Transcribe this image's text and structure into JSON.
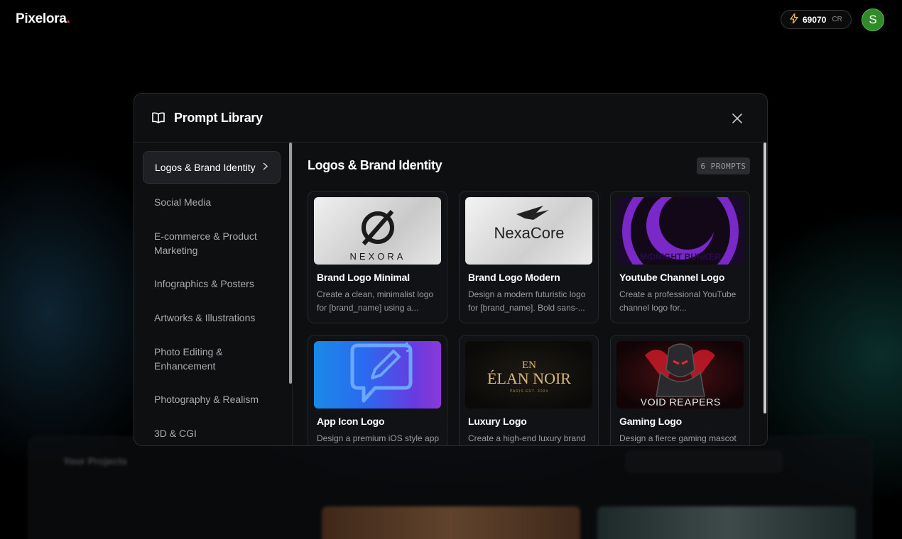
{
  "app": {
    "name": "Pixelora",
    "name_dot": "."
  },
  "topbar": {
    "credits_amount": "69070",
    "credits_unit": "CR",
    "avatar_initial": "S"
  },
  "background": {
    "projects_title": "Your Projects"
  },
  "modal": {
    "title": "Prompt Library",
    "close_label": "×"
  },
  "sidebar": {
    "items": [
      {
        "label": "Logos & Brand Identity",
        "active": true
      },
      {
        "label": "Social Media"
      },
      {
        "label": "E-commerce & Product Marketing"
      },
      {
        "label": "Infographics & Posters"
      },
      {
        "label": "Artworks & Illustrations"
      },
      {
        "label": "Photo Editing & Enhancement"
      },
      {
        "label": "Photography & Realism"
      },
      {
        "label": "3D & CGI"
      }
    ]
  },
  "content": {
    "title": "Logos & Brand Identity",
    "count_badge": "6 PROMPTS",
    "cards": [
      {
        "title": "Brand Logo Minimal",
        "desc": "Create a clean, minimalist logo for [brand_name] using a...",
        "thumb_text": "NEXORA",
        "thumb_symbol": "Ø"
      },
      {
        "title": "Brand Logo Modern",
        "desc": "Design a modern futuristic logo for [brand_name]. Bold sans-...",
        "thumb_text": "NexaCore"
      },
      {
        "title": "Youtube Channel Logo",
        "desc": "Create a professional YouTube channel logo for...",
        "thumb_text": "MIDNIGHT BUNKER"
      },
      {
        "title": "App Icon Logo",
        "desc": "Design a premium iOS style app",
        "thumb_text": ""
      },
      {
        "title": "Luxury Logo",
        "desc": "Create a high-end luxury brand",
        "thumb_text": "ÉLAN NOIR",
        "thumb_mono": "EN",
        "thumb_sub": "PARIS EST. 2024"
      },
      {
        "title": "Gaming Logo",
        "desc": "Design a fierce gaming mascot",
        "thumb_text": "VOID REAPERS"
      }
    ]
  },
  "colors": {
    "accent_dot": "#e23a4a",
    "avatar": "#2f8a2a",
    "bolt": "#f5b84a"
  }
}
